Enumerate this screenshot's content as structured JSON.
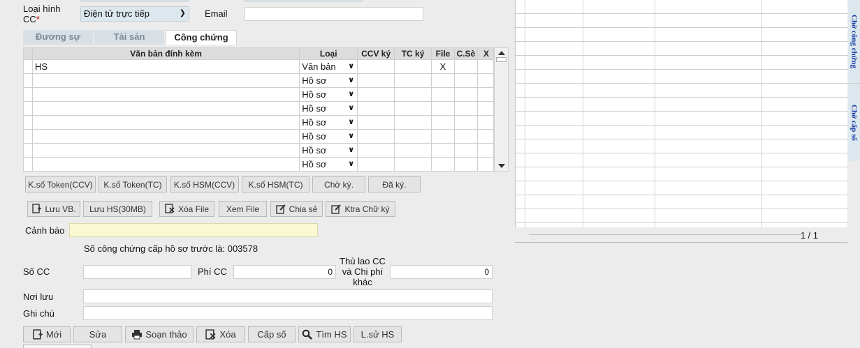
{
  "form": {
    "loai_hinh_label": "Loại hình CC",
    "required_mark": "*",
    "loai_hinh_value": "Điện tử trực tiếp",
    "email_label": "Email",
    "email_value": ""
  },
  "tabs": [
    {
      "label": "Đương sự"
    },
    {
      "label": "Tài sản"
    },
    {
      "label": "Công chứng"
    }
  ],
  "attach_table": {
    "headers": [
      "Văn bản đính kèm",
      "Loại",
      "CCV ký",
      "TC ký",
      "File",
      "C.Sè",
      "X"
    ],
    "rows": [
      {
        "name": "HS",
        "type": "Văn bản",
        "file": "X"
      },
      {
        "name": "",
        "type": "Hồ sơ",
        "file": ""
      },
      {
        "name": "",
        "type": "Hồ sơ",
        "file": ""
      },
      {
        "name": "",
        "type": "Hồ sơ",
        "file": ""
      },
      {
        "name": "",
        "type": "Hồ sơ",
        "file": ""
      },
      {
        "name": "",
        "type": "Hồ sơ",
        "file": ""
      },
      {
        "name": "",
        "type": "Hồ sơ",
        "file": ""
      },
      {
        "name": "",
        "type": "Hồ sơ",
        "file": ""
      }
    ]
  },
  "sign_buttons": [
    "K.số Token(CCV)",
    "K.số Token(TC)",
    "K.số HSM(CCV)",
    "K.số HSM(TC)",
    "Chờ ký.",
    "Đã ký."
  ],
  "file_buttons": {
    "luu_vb": "Lưu VB.",
    "luu_hs": "Lưu HS(30MB)",
    "xoa_file": "Xóa File",
    "xem_file": "Xem File",
    "chia_se": "Chia sẻ",
    "ktra_chu_ky": "Ktra Chữ ký"
  },
  "canh_bao_label": "Cảnh báo",
  "canh_bao_value": "",
  "info_text": "Số công chứng cấp hồ sơ trước là: 003578",
  "so_cc_label": "Số CC",
  "so_cc_value": "",
  "phi_cc_label": "Phí CC",
  "phi_cc_value": "0",
  "thu_lao_label_1": "Thù lao CC",
  "thu_lao_label_2": "và Chi phí",
  "thu_lao_label_3": "khác",
  "thu_lao_value": "0",
  "noi_luu_label": "Nơi lưu",
  "noi_luu_value": "",
  "ghi_chu_label": "Ghi chú",
  "ghi_chu_value": "",
  "action_buttons": {
    "moi": "Mới",
    "sua": "Sửa",
    "soan_thao": "Soạn thảo",
    "xoa": "Xóa",
    "cap_so": "Cấp số",
    "tim_hs": "Tìm HS",
    "lsu_hs": "L.sử HS"
  },
  "right_panel": {
    "pagination": "1 / 1",
    "vtab_1": "Chờ công chứng",
    "vtab_2": "Chờ cấp số"
  },
  "colors": {
    "background": "#ececec",
    "select_bg": "#dde7ee",
    "warning_bg": "#fbf8d4",
    "vtab_text": "#1a3fa8",
    "required": "#c00000"
  }
}
